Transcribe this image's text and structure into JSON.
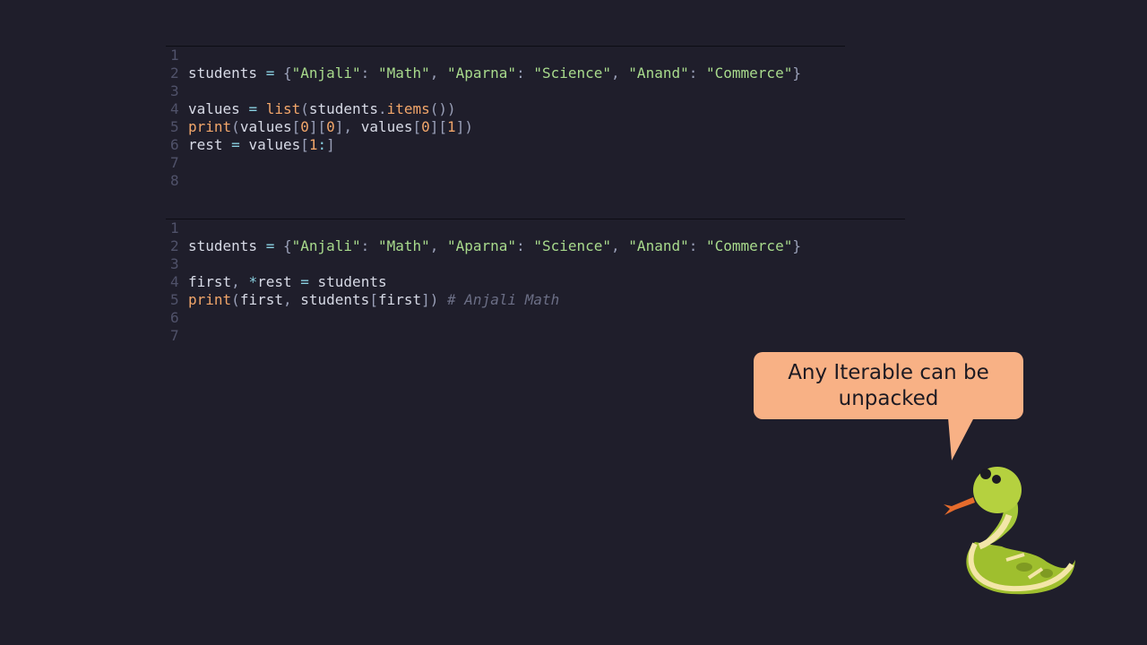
{
  "editors": [
    {
      "lines": [
        {
          "num": "1",
          "tokens": []
        },
        {
          "num": "2",
          "tokens": [
            {
              "t": "students ",
              "c": "id"
            },
            {
              "t": "=",
              "c": "op"
            },
            {
              "t": " {",
              "c": "pun"
            },
            {
              "t": "\"Anjali\"",
              "c": "str"
            },
            {
              "t": ": ",
              "c": "pun"
            },
            {
              "t": "\"Math\"",
              "c": "str"
            },
            {
              "t": ", ",
              "c": "pun"
            },
            {
              "t": "\"Aparna\"",
              "c": "str"
            },
            {
              "t": ": ",
              "c": "pun"
            },
            {
              "t": "\"Science\"",
              "c": "str"
            },
            {
              "t": ", ",
              "c": "pun"
            },
            {
              "t": "\"Anand\"",
              "c": "str"
            },
            {
              "t": ": ",
              "c": "pun"
            },
            {
              "t": "\"Commerce\"",
              "c": "str"
            },
            {
              "t": "}",
              "c": "pun"
            }
          ]
        },
        {
          "num": "3",
          "tokens": []
        },
        {
          "num": "4",
          "tokens": [
            {
              "t": "values ",
              "c": "id"
            },
            {
              "t": "=",
              "c": "op"
            },
            {
              "t": " ",
              "c": "id"
            },
            {
              "t": "list",
              "c": "fn"
            },
            {
              "t": "(",
              "c": "pun"
            },
            {
              "t": "students",
              "c": "id"
            },
            {
              "t": ".",
              "c": "pun"
            },
            {
              "t": "items",
              "c": "fn"
            },
            {
              "t": "())",
              "c": "pun"
            }
          ]
        },
        {
          "num": "5",
          "tokens": [
            {
              "t": "print",
              "c": "fn"
            },
            {
              "t": "(",
              "c": "pun"
            },
            {
              "t": "values",
              "c": "id"
            },
            {
              "t": "[",
              "c": "pun"
            },
            {
              "t": "0",
              "c": "num"
            },
            {
              "t": "][",
              "c": "pun"
            },
            {
              "t": "0",
              "c": "num"
            },
            {
              "t": "], ",
              "c": "pun"
            },
            {
              "t": "values",
              "c": "id"
            },
            {
              "t": "[",
              "c": "pun"
            },
            {
              "t": "0",
              "c": "num"
            },
            {
              "t": "][",
              "c": "pun"
            },
            {
              "t": "1",
              "c": "num"
            },
            {
              "t": "])",
              "c": "pun"
            }
          ]
        },
        {
          "num": "6",
          "tokens": [
            {
              "t": "rest ",
              "c": "id"
            },
            {
              "t": "=",
              "c": "op"
            },
            {
              "t": " values",
              "c": "id"
            },
            {
              "t": "[",
              "c": "pun"
            },
            {
              "t": "1",
              "c": "num"
            },
            {
              "t": ":",
              "c": "op"
            },
            {
              "t": "]",
              "c": "pun"
            }
          ]
        },
        {
          "num": "7",
          "tokens": []
        },
        {
          "num": "8",
          "tokens": []
        }
      ]
    },
    {
      "lines": [
        {
          "num": "1",
          "tokens": []
        },
        {
          "num": "2",
          "tokens": [
            {
              "t": "students ",
              "c": "id"
            },
            {
              "t": "=",
              "c": "op"
            },
            {
              "t": " {",
              "c": "pun"
            },
            {
              "t": "\"Anjali\"",
              "c": "str"
            },
            {
              "t": ": ",
              "c": "pun"
            },
            {
              "t": "\"Math\"",
              "c": "str"
            },
            {
              "t": ", ",
              "c": "pun"
            },
            {
              "t": "\"Aparna\"",
              "c": "str"
            },
            {
              "t": ": ",
              "c": "pun"
            },
            {
              "t": "\"Science\"",
              "c": "str"
            },
            {
              "t": ", ",
              "c": "pun"
            },
            {
              "t": "\"Anand\"",
              "c": "str"
            },
            {
              "t": ": ",
              "c": "pun"
            },
            {
              "t": "\"Commerce\"",
              "c": "str"
            },
            {
              "t": "}",
              "c": "pun"
            }
          ]
        },
        {
          "num": "3",
          "tokens": []
        },
        {
          "num": "4",
          "tokens": [
            {
              "t": "first",
              "c": "id"
            },
            {
              "t": ", ",
              "c": "pun"
            },
            {
              "t": "*",
              "c": "op"
            },
            {
              "t": "rest ",
              "c": "id"
            },
            {
              "t": "=",
              "c": "op"
            },
            {
              "t": " students",
              "c": "id"
            }
          ]
        },
        {
          "num": "5",
          "tokens": [
            {
              "t": "print",
              "c": "fn"
            },
            {
              "t": "(",
              "c": "pun"
            },
            {
              "t": "first",
              "c": "id"
            },
            {
              "t": ", ",
              "c": "pun"
            },
            {
              "t": "students",
              "c": "id"
            },
            {
              "t": "[",
              "c": "pun"
            },
            {
              "t": "first",
              "c": "id"
            },
            {
              "t": "]) ",
              "c": "pun"
            },
            {
              "t": "# Anjali Math",
              "c": "comment"
            }
          ]
        },
        {
          "num": "6",
          "tokens": []
        },
        {
          "num": "7",
          "tokens": []
        }
      ]
    }
  ],
  "bubble": {
    "text": "Any Iterable can be unpacked"
  },
  "mascot": {
    "icon": "python-snake-icon"
  },
  "colors": {
    "background": "#1f1e2b",
    "bubble": "#f8b185",
    "string": "#a8da8c",
    "function": "#f2a66a",
    "operator": "#8ad0e0",
    "comment": "#6b6e85"
  }
}
